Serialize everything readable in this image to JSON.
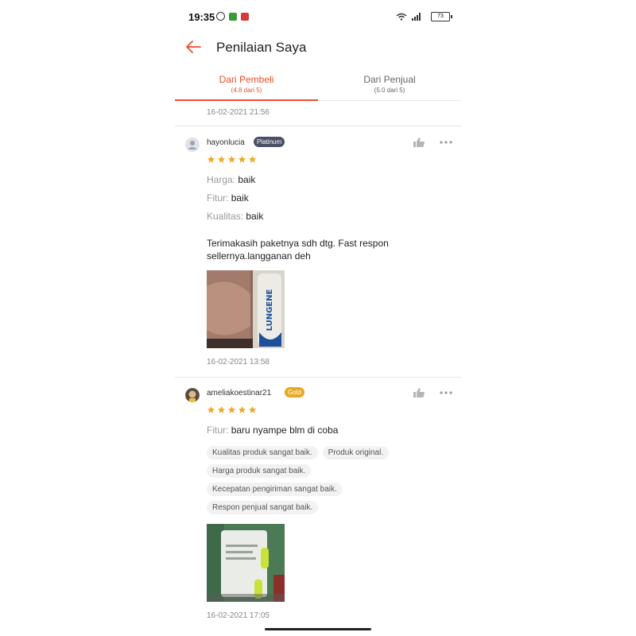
{
  "status_bar": {
    "time": "19:35",
    "battery": "73"
  },
  "header": {
    "title": "Penilaian Saya"
  },
  "tabs": [
    {
      "label": "Dari Pembeli",
      "sub": "(4.8 dari 5)"
    },
    {
      "label": "Dari Penjual",
      "sub": "(5.0 dari 5)"
    }
  ],
  "top_timestamp": "16-02-2021 21:56",
  "reviews": [
    {
      "username": "hayonlucia",
      "badge": "Platinum",
      "rating": 5,
      "attributes": [
        {
          "key": "Harga:",
          "value": "baik"
        },
        {
          "key": "Fitur:",
          "value": "baik"
        },
        {
          "key": "Kualitas:",
          "value": "baik"
        }
      ],
      "comment": "Terimakasih paketnya sdh dtg. Fast respon sellernya.langganan deh",
      "photo_text": "LUNGENE",
      "timestamp": "16-02-2021 13:58"
    },
    {
      "username": "ameliakoestinar21",
      "badge": "Gold",
      "rating": 5,
      "attributes": [
        {
          "key": "Fitur:",
          "value": "baru nyampe blm di coba"
        }
      ],
      "tags": [
        "Kualitas produk sangat baik.",
        "Produk original.",
        "Harga produk sangat baik.",
        "Kecepatan pengiriman sangat baik.",
        "Respon penjual sangat baik."
      ],
      "timestamp": "16-02-2021 17:05"
    }
  ],
  "colors": {
    "accent": "#ee4d2d",
    "star": "#f5a623",
    "badge_platinum": "#4a5066",
    "badge_gold": "#e8a922"
  }
}
